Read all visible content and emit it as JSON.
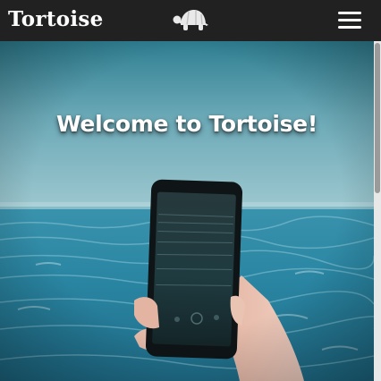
{
  "navbar": {
    "brand": "Tortoise",
    "logo_icon": "tortoise-icon",
    "menu_icon": "hamburger-menu-icon"
  },
  "hero": {
    "title": "Welcome to Tortoise!",
    "image_subject": "hand holding a smartphone in front of the ocean"
  },
  "colors": {
    "navbar_bg": "#212121",
    "brand_text": "#ffffff",
    "sea": "#2d8aa6",
    "sky": "#6ba7b8"
  }
}
